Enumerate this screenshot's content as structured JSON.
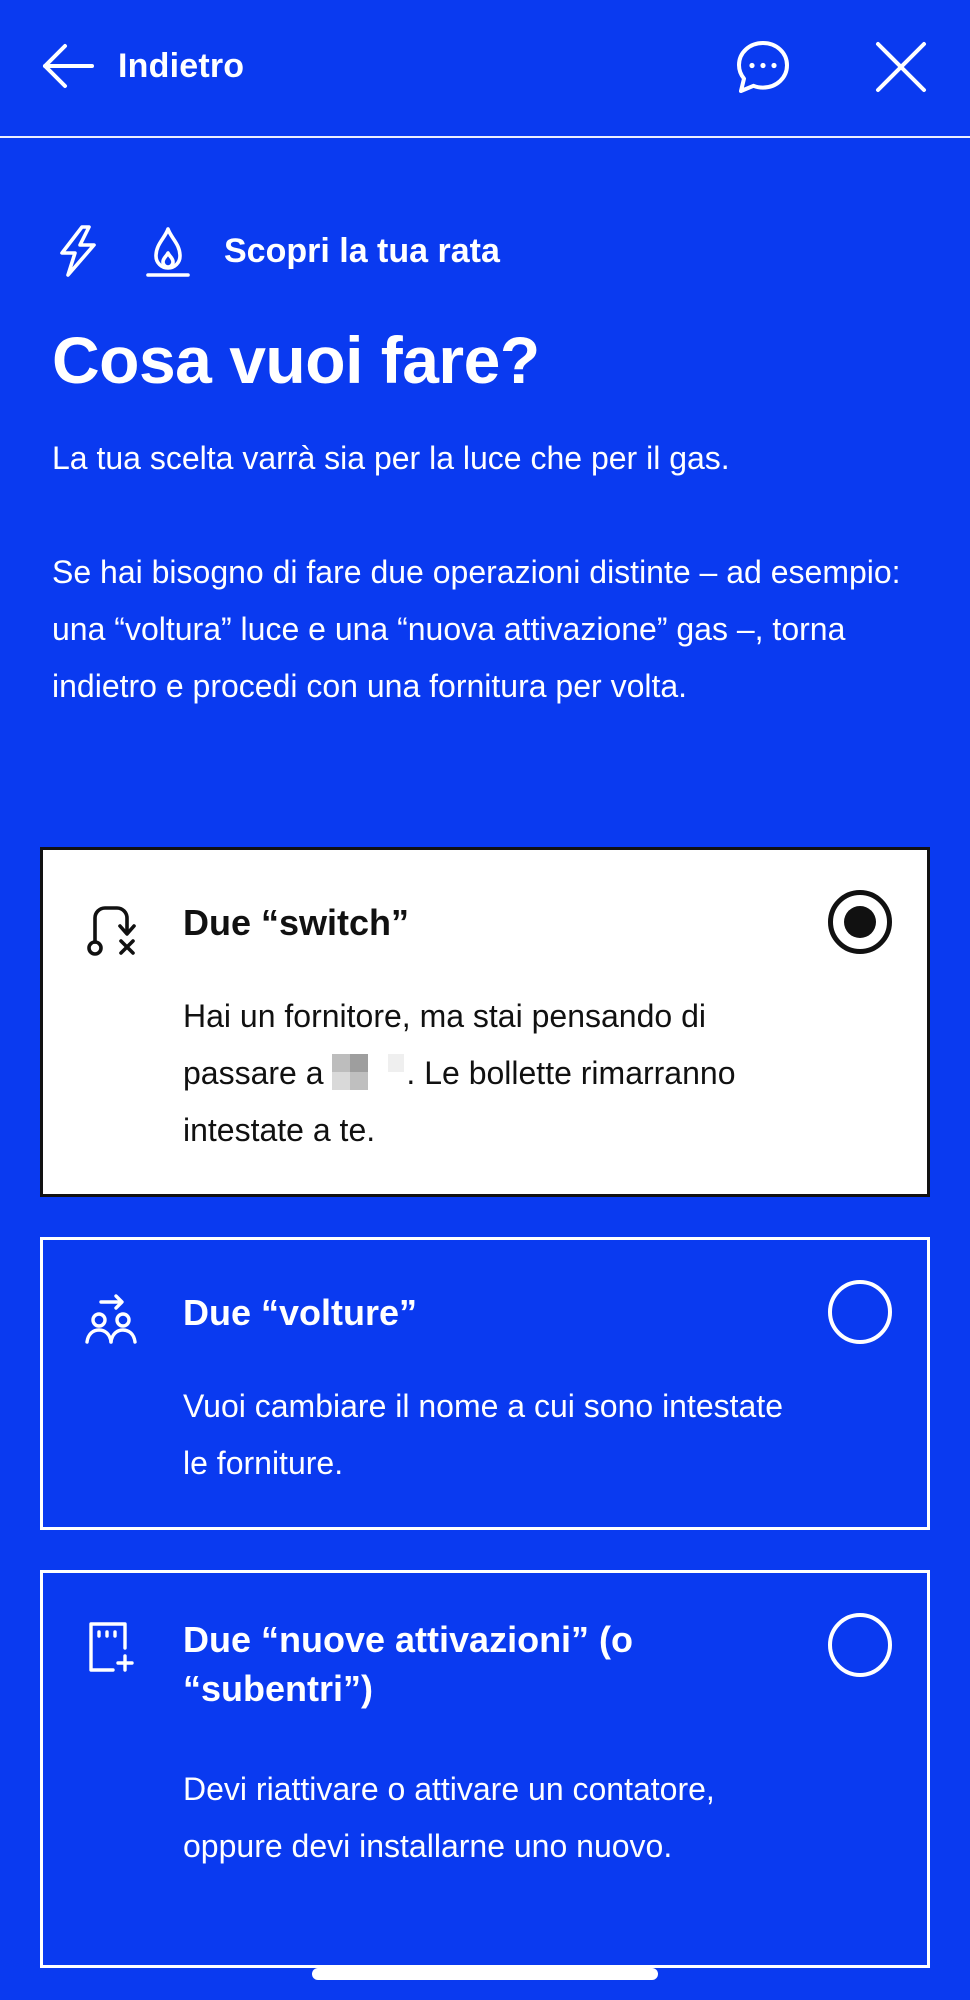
{
  "header": {
    "back_label": "Indietro",
    "icons": {
      "back": "arrow-left-icon",
      "chat": "chat-bubble-icon",
      "close": "close-icon"
    }
  },
  "eyebrow": {
    "label": "Scopri la tua rata",
    "icons": [
      "lightning-icon",
      "flame-icon"
    ]
  },
  "title": "Cosa vuoi fare?",
  "intro": {
    "paragraph1": "La tua scelta varrà sia per la luce che per il gas.",
    "paragraph2": "Se hai bisogno di fare due operazioni distinte – ad esempio: una “voltura” luce e una “nuova attivazione” gas –, torna indietro e procedi con una fornitura per volta."
  },
  "options": [
    {
      "icon": "switch-route-icon",
      "title": "Due “switch”",
      "desc_before": "Hai un fornitore, ma stai pensando di passare a ",
      "desc_after": ". Le bollette rimarranno intestate a te.",
      "selected": true
    },
    {
      "icon": "people-transfer-icon",
      "title": "Due “volture”",
      "desc": "Vuoi cambiare il nome a cui sono intestate le forniture.",
      "selected": false
    },
    {
      "icon": "meter-add-icon",
      "title": "Due “nuove attivazioni” (o “subentri”)",
      "desc": "Devi riattivare o attivare un contatore, oppure devi installarne uno nuovo.",
      "selected": false
    }
  ],
  "colors": {
    "background": "#0a3af0",
    "selected_card": "#ffffff",
    "text_dark": "#111111"
  }
}
